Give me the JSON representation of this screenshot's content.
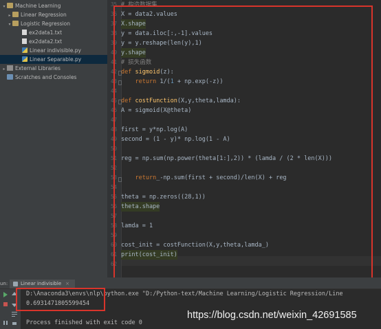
{
  "project_tree": {
    "items": [
      {
        "label": "Machine Learning",
        "icon": "folder-icon",
        "arrow": "▾"
      },
      {
        "label": "Linear Regression",
        "icon": "folder-icon",
        "arrow": "▸"
      },
      {
        "label": "Logistic Regression",
        "icon": "folder-icon",
        "arrow": "▾"
      },
      {
        "label": "ex2data1.txt",
        "icon": "text-file-icon",
        "arrow": ""
      },
      {
        "label": "ex2data2.txt",
        "icon": "text-file-icon",
        "arrow": ""
      },
      {
        "label": "Linear indivisible.py",
        "icon": "python-file-icon",
        "arrow": ""
      },
      {
        "label": "Linear Separable.py",
        "icon": "python-file-icon",
        "arrow": ""
      },
      {
        "label": "External Libraries",
        "icon": "library-icon",
        "arrow": "▸"
      },
      {
        "label": "Scratches and Consoles",
        "icon": "scratches-icon",
        "arrow": ""
      }
    ]
  },
  "editor": {
    "line_numbers": [
      "35",
      "36",
      "37",
      "38",
      "39",
      "40",
      "41",
      "42",
      "43",
      "44",
      "45",
      "46",
      "47",
      "48",
      "49",
      "50",
      "51",
      "52",
      "53",
      "54",
      "55",
      "56",
      "57",
      "58",
      "59",
      "60",
      "61",
      "62"
    ],
    "code": {
      "c35": "# 构造数据集",
      "c36": "X = data2.values",
      "c37": "X.shape",
      "c38": "y = data.iloc[:,-1].values",
      "c39": "y = y.reshape(len(y),1)",
      "c40": "y.shape",
      "c41": "# 损失函数",
      "c42a": "def",
      "c42b": "sigmoid",
      "c42c": "(z):",
      "c43a": "return",
      "c43b": " 1/(",
      "c43c": "1",
      "c43d": " + np.exp(-z))",
      "c45a": "def",
      "c45b": "costFunction",
      "c45c": "(X,y,theta,lamda):",
      "c46": "A = sigmoid(X@theta)",
      "c48": "first = y*np.log(A)",
      "c49": "second = (1 - y)* np.log(1 - A)",
      "c51": "reg = np.sum(np.power(theta[1:],2)) * (lamda / (2 * len(X)))",
      "c53a": "return",
      "c53b": "_-np.sum(first + second)/len(X) + reg",
      "c55": "theta = np.zeros((28,1))",
      "c56": "theta.shape",
      "c58": "lamda = 1",
      "c60": "cost_init = costFunction(X,y,theta,lamda_)",
      "c61": "print(cost_init)"
    }
  },
  "run_panel": {
    "label": "un:",
    "tab_label": "Linear indivisible",
    "tab_close": "×",
    "command": "D:\\Anaconda3\\envs\\nlp\\python.exe \"D:/Python-text/Machine Learning/Logistic Regression/Line",
    "output_value": "0.6931471805599454",
    "exit_message": "Process finished with exit code 0"
  },
  "watermark": "https://blog.csdn.net/weixin_42691585",
  "colors": {
    "annotation_red": "#d9342b",
    "keyword": "#cc7832",
    "function_name": "#ffc66d",
    "number": "#6897bb",
    "comment": "#808080"
  }
}
